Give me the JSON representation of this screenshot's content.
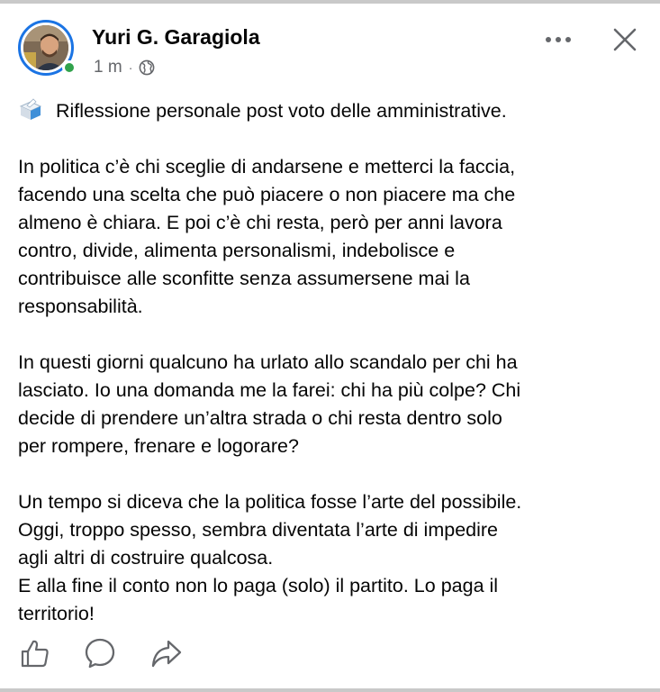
{
  "post": {
    "author": "Yuri G. Garagiola",
    "time": "1 m",
    "separator": "·",
    "audience_icon": "globe-icon",
    "title_emoji": "ballot-box-icon",
    "title": "Riflessione personale post voto delle amministrative.",
    "paragraph1": [
      "In politica c’è chi sceglie di andarsene e metterci la faccia,",
      "facendo una scelta che può piacere o non piacere ma che",
      "almeno è chiara. E poi c’è chi resta, però per anni lavora",
      "contro, divide, alimenta personalismi, indebolisce e",
      "contribuisce alle sconfitte senza assumersene mai la",
      "responsabilità."
    ],
    "paragraph2": [
      "In questi giorni qualcuno ha urlato allo scandalo per chi ha",
      "lasciato. Io una domanda me la farei: chi ha più colpe? Chi",
      "decide di prendere un’altra strada o chi resta dentro solo",
      "per rompere, frenare e logorare?"
    ],
    "paragraph3": [
      "Un tempo si diceva che la politica fosse l’arte del possibile.",
      "Oggi, troppo spesso, sembra diventata l’arte di impedire",
      "agli altri di costruire qualcosa.",
      "E alla fine il conto non lo paga (solo) il partito. Lo paga il",
      "territorio!"
    ]
  },
  "icons": {
    "more": "more-icon",
    "close": "close-icon",
    "like": "like-icon",
    "comment": "comment-icon",
    "share": "share-icon"
  },
  "colors": {
    "ring": "#1b74e4",
    "online": "#31a24c",
    "secondary_text": "#65676b"
  }
}
